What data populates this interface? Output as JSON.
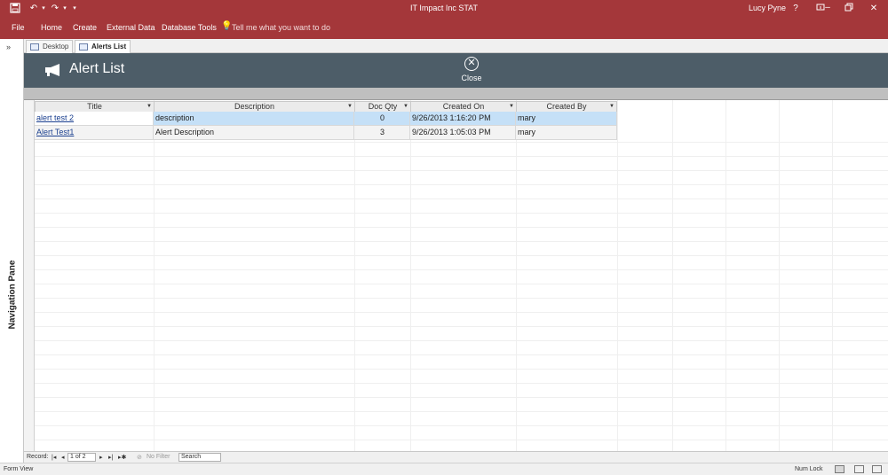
{
  "app": {
    "window_title": "IT Impact Inc STAT",
    "user_name": "Lucy Pyne",
    "help_glyph": "?"
  },
  "ribbon": {
    "tabs": [
      "File",
      "Home",
      "Create",
      "External Data",
      "Database Tools"
    ],
    "tell_me": "Tell me what you want to do"
  },
  "nav_pane": {
    "label": "Navigation Pane",
    "toggle": "»"
  },
  "doc_tabs": [
    {
      "label": "Desktop",
      "active": false
    },
    {
      "label": "Alerts List",
      "active": true
    }
  ],
  "form": {
    "title": "Alert List",
    "close_label": "Close"
  },
  "grid": {
    "columns": [
      "Title",
      "Description",
      "Doc Qty",
      "Created On",
      "Created By"
    ],
    "rows": [
      {
        "title": "alert test 2",
        "description": "description",
        "doc_qty": "0",
        "created_on": "9/26/2013 1:16:20 PM",
        "created_by": "mary"
      },
      {
        "title": "Alert Test1",
        "description": "Alert Description",
        "doc_qty": "3",
        "created_on": "9/26/2013 1:05:03 PM",
        "created_by": "mary"
      }
    ]
  },
  "record_nav": {
    "label": "Record:",
    "position": "1 of 2",
    "filter": "No Filter",
    "search": "Search"
  },
  "status_bar": {
    "view": "Form View",
    "num_lock": "Num Lock"
  },
  "colors": {
    "accent": "#a4373a",
    "form_header": "#4d5d68",
    "selected_row": "#c5e0f7"
  }
}
